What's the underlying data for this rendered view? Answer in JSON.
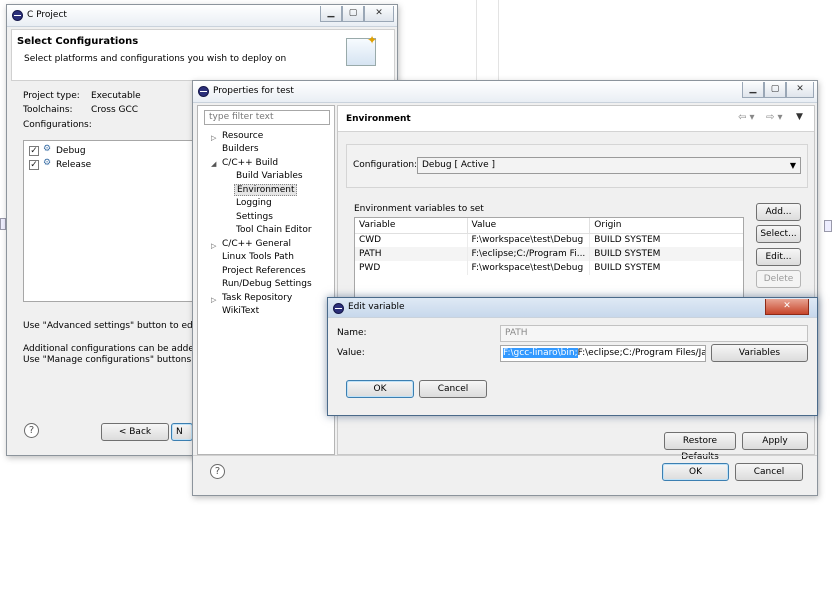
{
  "cproject": {
    "title": "C Project",
    "heading": "Select Configurations",
    "subheading": "Select platforms and configurations you wish to deploy on",
    "project_type_label": "Project type:",
    "project_type_value": "Executable",
    "toolchains_label": "Toolchains:",
    "toolchains_value": "Cross GCC",
    "configurations_label": "Configurations:",
    "configs": [
      "Debug",
      "Release"
    ],
    "hint1": "Use \"Advanced settings\" button to edit proj",
    "hint2": "Additional configurations can be added afte",
    "hint3": "Use \"Manage configurations\" buttons eithe",
    "back_label": "< Back",
    "next_label": "N",
    "help": "?"
  },
  "props": {
    "title": "Properties for test",
    "filter_placeholder": "type filter text",
    "tree": {
      "resource": "Resource",
      "builders": "Builders",
      "cbuild": "C/C++ Build",
      "build_variables": "Build Variables",
      "environment": "Environment",
      "logging": "Logging",
      "settings": "Settings",
      "toolchain_editor": "Tool Chain Editor",
      "cgeneral": "C/C++ General",
      "linux_tools": "Linux Tools Path",
      "project_refs": "Project References",
      "run_debug": "Run/Debug Settings",
      "task_repo": "Task Repository",
      "wikitext": "WikiText"
    },
    "page_title": "Environment",
    "config_label": "Configuration:",
    "config_value": "Debug  [ Active ]",
    "env_label": "Environment variables to set",
    "columns": [
      "Variable",
      "Value",
      "Origin"
    ],
    "rows": [
      {
        "variable": "CWD",
        "value": "F:\\workspace\\test\\Debug",
        "origin": "BUILD SYSTEM"
      },
      {
        "variable": "PATH",
        "value": "F:\\eclipse;C:/Program Fi...",
        "origin": "BUILD SYSTEM"
      },
      {
        "variable": "PWD",
        "value": "F:\\workspace\\test\\Debug",
        "origin": "BUILD SYSTEM"
      }
    ],
    "add": "Add...",
    "select": "Select...",
    "edit": "Edit...",
    "delete": "Delete",
    "restore": "Restore Defaults",
    "apply": "Apply",
    "ok": "OK",
    "cancel": "Cancel",
    "help": "?"
  },
  "editvar": {
    "title": "Edit variable",
    "name_label": "Name:",
    "name_value": "PATH",
    "value_label": "Value:",
    "value_selected": "F:\\gcc-linaro\\bin;",
    "value_rest": "F:\\eclipse;C:/Program Files/Java/",
    "variables": "Variables",
    "ok": "OK",
    "cancel": "Cancel"
  },
  "colors": {
    "selection": "#3399ff",
    "accent": "#3c7fb1"
  }
}
